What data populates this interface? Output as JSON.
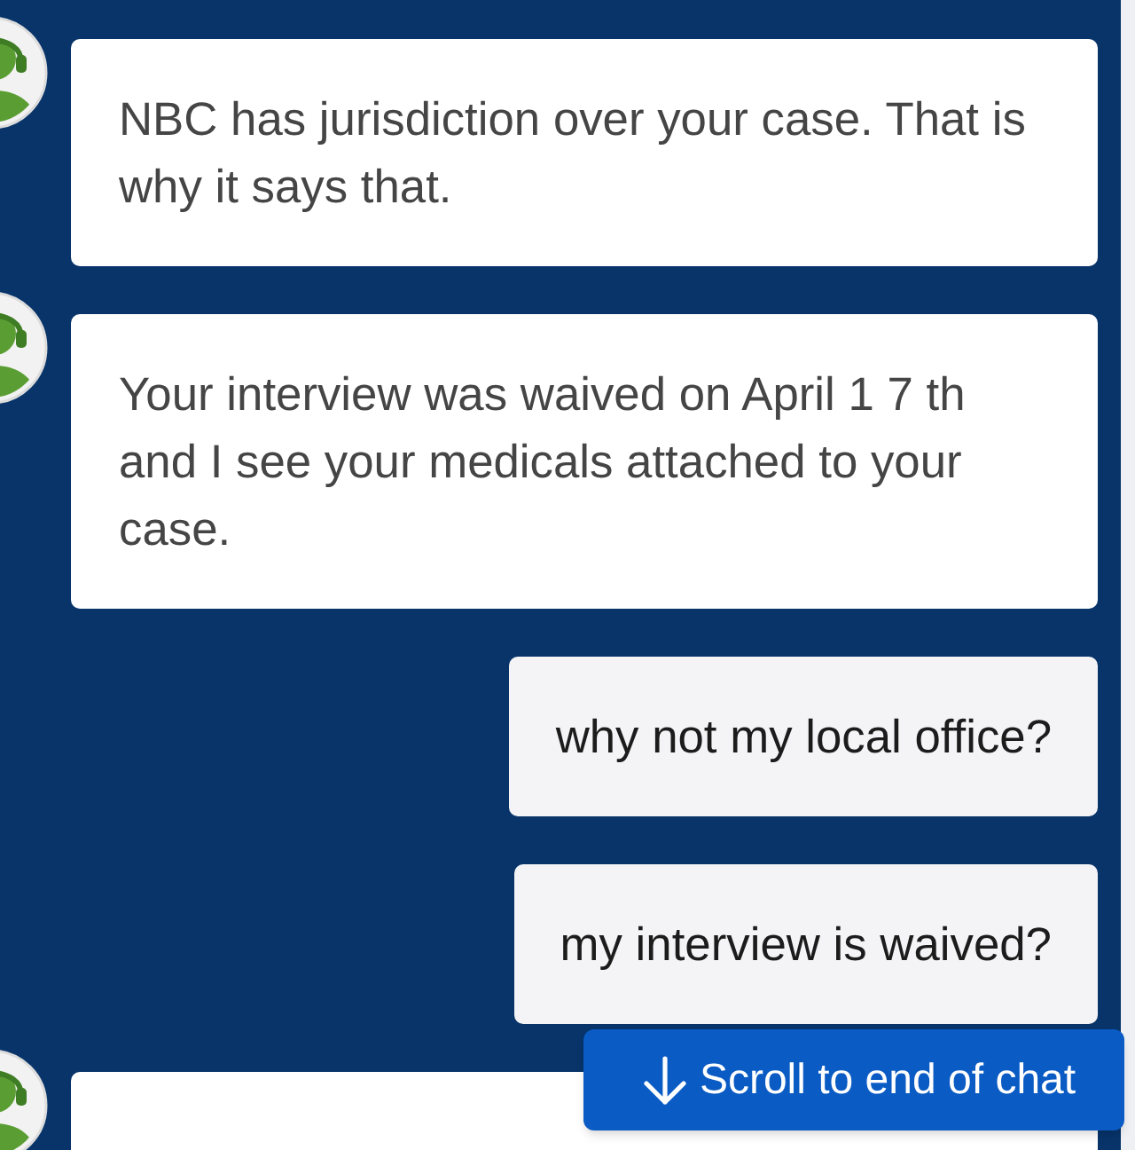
{
  "messages": [
    {
      "kind": "agent",
      "text": "NBC has jurisdiction over your case. That is why it says that."
    },
    {
      "kind": "agent",
      "text": "Your interview was waived on April 1 7 th and I see your medicals attached to your case."
    },
    {
      "kind": "user",
      "text": "why not my local office?"
    },
    {
      "kind": "user",
      "text": "my interview is waived?"
    },
    {
      "kind": "agent"
    }
  ],
  "scroll_button": {
    "label": "Scroll to end of chat"
  }
}
